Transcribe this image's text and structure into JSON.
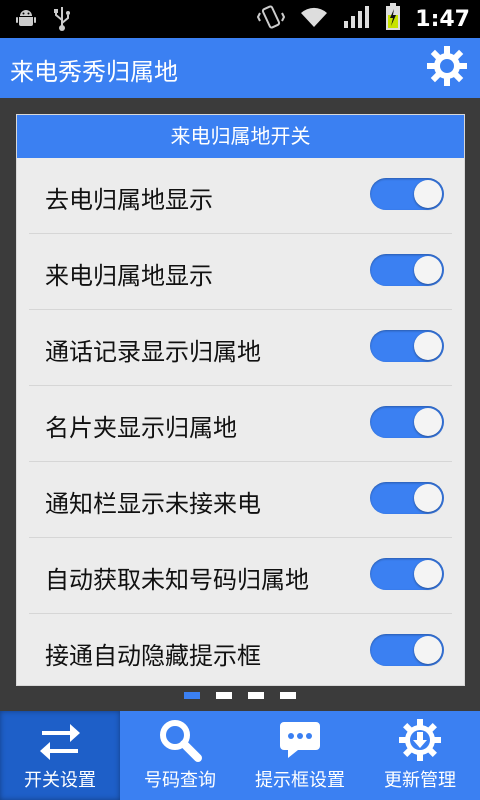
{
  "status_bar": {
    "time": "1:47",
    "icons": [
      "android-debug-icon",
      "usb-icon",
      "vibrate-icon",
      "wifi-icon",
      "signal-icon",
      "battery-charging-icon"
    ]
  },
  "app": {
    "title": "来电秀秀归属地"
  },
  "card": {
    "header": "来电归属地开关",
    "rows": [
      {
        "label": "去电归属地显示",
        "on": true
      },
      {
        "label": "来电归属地显示",
        "on": true
      },
      {
        "label": "通话记录显示归属地",
        "on": true
      },
      {
        "label": "名片夹显示归属地",
        "on": true
      },
      {
        "label": "通知栏显示未接来电",
        "on": true
      },
      {
        "label": "自动获取未知号码归属地",
        "on": true
      },
      {
        "label": "接通自动隐藏提示框",
        "on": true
      }
    ]
  },
  "pager": {
    "pages": 4,
    "active": 1
  },
  "bottom_nav": {
    "items": [
      {
        "label": "开关设置",
        "icon": "swap-arrows-icon",
        "active": true
      },
      {
        "label": "号码查询",
        "icon": "search-icon",
        "active": false
      },
      {
        "label": "提示框设置",
        "icon": "chat-bubble-icon",
        "active": false
      },
      {
        "label": "更新管理",
        "icon": "update-gear-icon",
        "active": false
      }
    ]
  },
  "colors": {
    "accent": "#3b80f2",
    "background": "#3b3b3b",
    "card": "#ececec"
  }
}
